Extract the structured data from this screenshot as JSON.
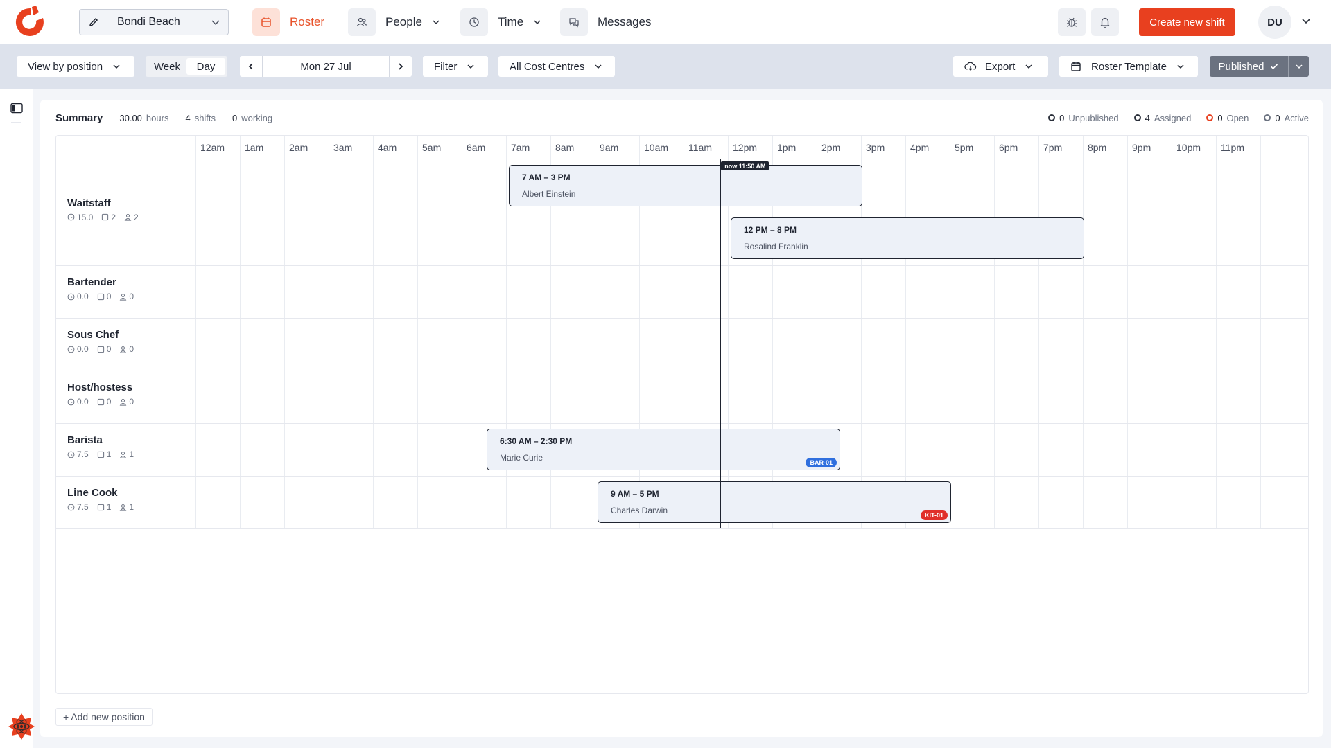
{
  "app": {
    "brand_color": "#e8401f",
    "user_initials": "DU"
  },
  "location": {
    "name": "Bondi Beach"
  },
  "nav": [
    {
      "id": "roster",
      "label": "Roster",
      "icon": "calendar-icon",
      "active": true
    },
    {
      "id": "people",
      "label": "People",
      "icon": "users-icon",
      "dropdown": true
    },
    {
      "id": "time",
      "label": "Time",
      "icon": "clock-icon",
      "dropdown": true
    },
    {
      "id": "messages",
      "label": "Messages",
      "icon": "chat-icon"
    }
  ],
  "header_actions": {
    "create_label": "Create new shift"
  },
  "toolbar": {
    "view_by": "View by position",
    "week": "Week",
    "day": "Day",
    "date": "Mon 27 Jul",
    "filter": "Filter",
    "cost_centres": "All Cost Centres",
    "export": "Export",
    "roster_template": "Roster Template",
    "published": "Published"
  },
  "summary": {
    "title": "Summary",
    "hours_value": "30.00",
    "hours_unit": "hours",
    "shifts_value": "4",
    "shifts_unit": "shifts",
    "working_value": "0",
    "working_unit": "working"
  },
  "legend": [
    {
      "count": "0",
      "label": "Unpublished"
    },
    {
      "count": "4",
      "label": "Assigned"
    },
    {
      "count": "0",
      "label": "Open"
    },
    {
      "count": "0",
      "label": "Active"
    }
  ],
  "hours": [
    "12am",
    "1am",
    "2am",
    "3am",
    "4am",
    "5am",
    "6am",
    "7am",
    "8am",
    "9am",
    "10am",
    "11am",
    "12pm",
    "1pm",
    "2pm",
    "3pm",
    "4pm",
    "5pm",
    "6pm",
    "7pm",
    "8pm",
    "9pm",
    "10pm",
    "11pm"
  ],
  "now_label": "now 11:50 AM",
  "now_hour": 11.833,
  "positions": [
    {
      "name": "Waitstaff",
      "hours": "15.0",
      "shifts": "2",
      "people": "2"
    },
    {
      "name": "Bartender",
      "hours": "0.0",
      "shifts": "0",
      "people": "0"
    },
    {
      "name": "Sous Chef",
      "hours": "0.0",
      "shifts": "0",
      "people": "0"
    },
    {
      "name": "Host/hostess",
      "hours": "0.0",
      "shifts": "0",
      "people": "0"
    },
    {
      "name": "Barista",
      "hours": "7.5",
      "shifts": "1",
      "people": "1"
    },
    {
      "name": "Line Cook",
      "hours": "7.5",
      "shifts": "1",
      "people": "1"
    }
  ],
  "shifts": [
    {
      "time": "7 AM – 3 PM",
      "person": "Albert Einstein",
      "start": 7,
      "end": 15
    },
    {
      "time": "12 PM – 8 PM",
      "person": "Rosalind Franklin",
      "start": 12,
      "end": 20
    },
    {
      "time": "6:30 AM – 2:30 PM",
      "person": "Marie Curie",
      "start": 6.5,
      "end": 14.5,
      "tag": "BAR-01",
      "tag_color": "#2f6fde"
    },
    {
      "time": "9 AM – 5 PM",
      "person": "Charles Darwin",
      "start": 9,
      "end": 17,
      "tag": "KIT-01",
      "tag_color": "#e0302a"
    }
  ],
  "add_position_label": "+ Add new position"
}
